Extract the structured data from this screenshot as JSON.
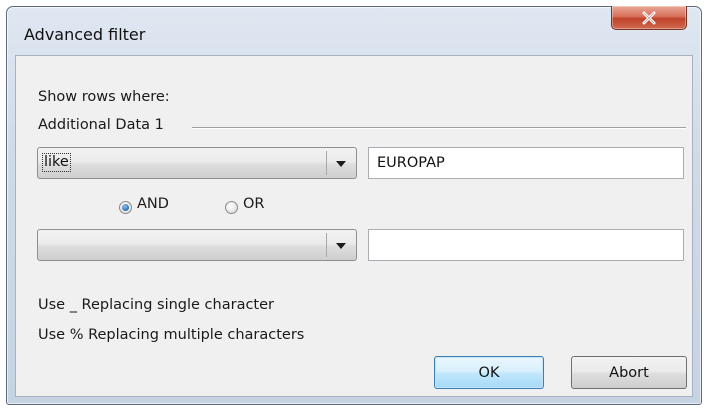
{
  "window": {
    "title": "Advanced filter",
    "close_glyph": "X"
  },
  "filter": {
    "show_rows_label": "Show rows where:",
    "group_label": "Additional Data 1",
    "condition1": {
      "operator": "like",
      "value": "EUROPAP"
    },
    "logic": {
      "options": [
        "AND",
        "OR"
      ],
      "selected": "AND"
    },
    "condition2": {
      "operator": "",
      "value": ""
    },
    "hint1": "Use _ Replacing single character",
    "hint2": "Use % Replacing multiple characters"
  },
  "buttons": {
    "ok": "OK",
    "abort": "Abort"
  },
  "colors": {
    "close_button": "#c0432b",
    "default_button_border": "#3c7fb1",
    "radio_dot": "#2a6fb0"
  }
}
